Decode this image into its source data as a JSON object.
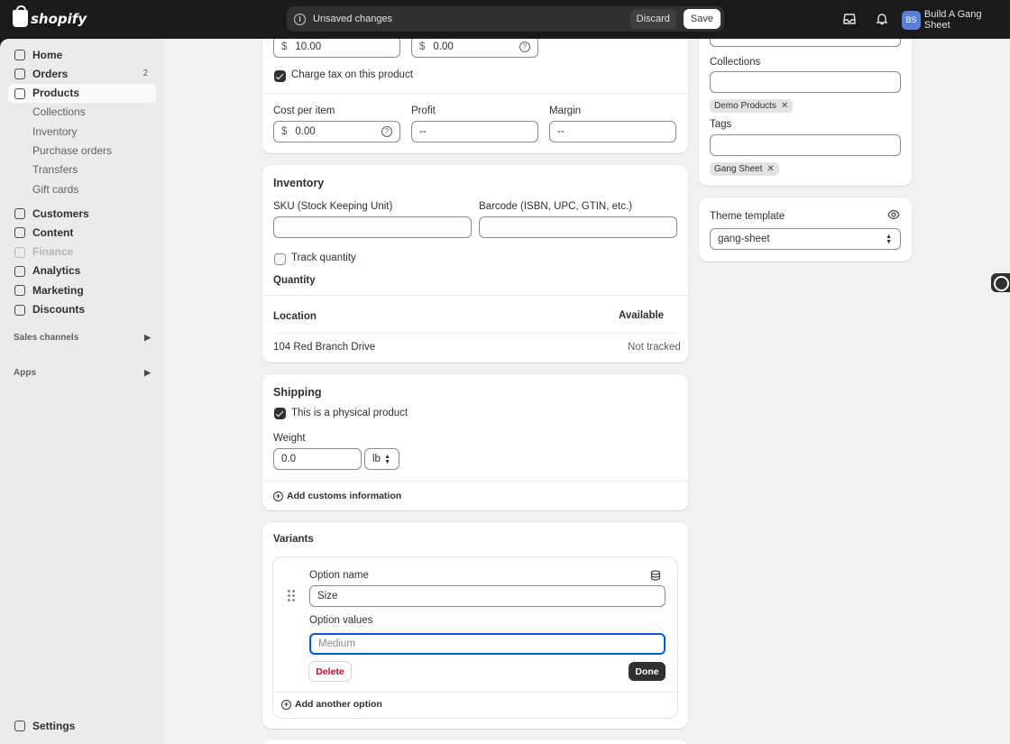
{
  "topbar": {
    "brand": "shopify",
    "unsaved_message": "Unsaved changes",
    "discard_label": "Discard",
    "save_label": "Save",
    "account_initials": "BS",
    "account_name": "Build A Gang Sheet",
    "accent": "#303030"
  },
  "sidebar": {
    "items": [
      {
        "label": "Home"
      },
      {
        "label": "Orders",
        "count": "2"
      },
      {
        "label": "Products"
      },
      {
        "label": "Collections"
      },
      {
        "label": "Inventory"
      },
      {
        "label": "Purchase orders"
      },
      {
        "label": "Transfers"
      },
      {
        "label": "Gift cards"
      },
      {
        "label": "Customers"
      },
      {
        "label": "Content"
      },
      {
        "label": "Finance"
      },
      {
        "label": "Analytics"
      },
      {
        "label": "Marketing"
      },
      {
        "label": "Discounts"
      }
    ],
    "sales_channels": "Sales channels",
    "apps": "Apps",
    "settings": "Settings"
  },
  "pricing": {
    "price_value": "10.00",
    "compare_value": "0.00",
    "currency": "$",
    "charge_tax": "Charge tax on this product",
    "cost_label": "Cost per item",
    "cost_value": "0.00",
    "profit_label": "Profit",
    "profit_value": "--",
    "margin_label": "Margin",
    "margin_value": "--"
  },
  "inventory": {
    "title": "Inventory",
    "sku_label": "SKU (Stock Keeping Unit)",
    "barcode_label": "Barcode (ISBN, UPC, GTIN, etc.)",
    "track_label": "Track quantity",
    "quantity_label": "Quantity",
    "location_header": "Location",
    "available_header": "Available",
    "location_name": "104 Red Branch Drive",
    "location_status": "Not tracked"
  },
  "shipping": {
    "title": "Shipping",
    "physical_label": "This is a physical product",
    "weight_label": "Weight",
    "weight_value": "0.0",
    "weight_unit": "lb",
    "customs_label": "Add customs information"
  },
  "variants": {
    "title": "Variants",
    "option_name_label": "Option name",
    "option_name_value": "Size",
    "option_values_label": "Option values",
    "option_value_placeholder": "Medium",
    "delete_label": "Delete",
    "done_label": "Done",
    "add_option_label": "Add another option"
  },
  "organization": {
    "collections_label": "Collections",
    "collection_tag": "Demo Products",
    "tags_label": "Tags",
    "tag_value": "Gang Sheet"
  },
  "theme": {
    "title": "Theme template",
    "value": "gang-sheet"
  }
}
